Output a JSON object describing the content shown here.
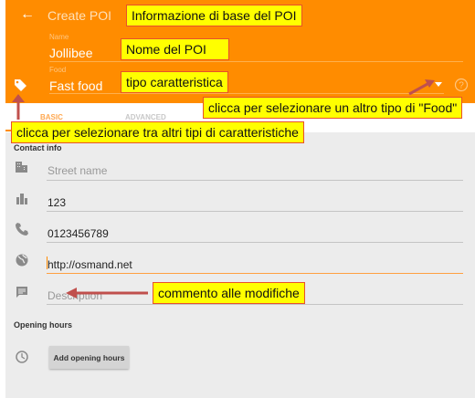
{
  "header": {
    "title": "Create POI",
    "name_label": "Name",
    "name_value": "Jollibee",
    "type_label": "Food",
    "type_value": "Fast food"
  },
  "tabs": [
    {
      "label": "BASIC",
      "active": true
    },
    {
      "label": "ADVANCED",
      "active": false
    }
  ],
  "contact": {
    "title": "Contact info",
    "fields": [
      {
        "icon": "building-icon",
        "value": "",
        "placeholder": "Street name"
      },
      {
        "icon": "house-number-icon",
        "value": "123",
        "placeholder": ""
      },
      {
        "icon": "phone-icon",
        "value": "0123456789",
        "placeholder": ""
      },
      {
        "icon": "globe-icon",
        "value": "http://osmand.net",
        "placeholder": ""
      },
      {
        "icon": "comment-icon",
        "value": "",
        "placeholder": "Description"
      }
    ]
  },
  "opening": {
    "title": "Opening hours",
    "button": "Add opening hours"
  },
  "annotations": {
    "basic_info": "Informazione di base del POI",
    "name": "Nome del POI",
    "type": "tipo caratteristica",
    "food_type": "clicca per selezionare un altro tipo di \"Food\"",
    "feature_types": "clicca per selezionare tra altri tipi di caratteristiche",
    "comment": "commento alle modifiche"
  },
  "colors": {
    "accent": "#ff8c00",
    "annotation_bg": "#ffff00",
    "arrow": "#c0504d"
  }
}
